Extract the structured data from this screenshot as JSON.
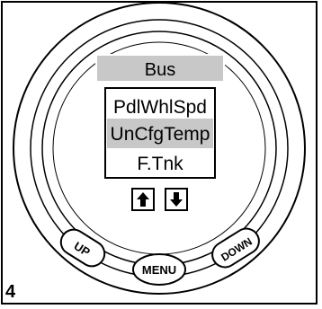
{
  "screen": {
    "header": "Bus",
    "items": [
      "PdlWhlSpd",
      "UnCfgTemp",
      "F.Tnk"
    ],
    "selected_index": 1
  },
  "buttons": {
    "up_label": "UP",
    "menu_label": "MENU",
    "down_label": "DOWN",
    "onscreen_up_icon": "arrow-up-icon",
    "onscreen_down_icon": "arrow-down-icon"
  },
  "figure_number": "4",
  "colors": {
    "screen_header_bg": "#c8c8c8",
    "selected_row_bg": "#c8c8c8",
    "outline": "#000000"
  }
}
